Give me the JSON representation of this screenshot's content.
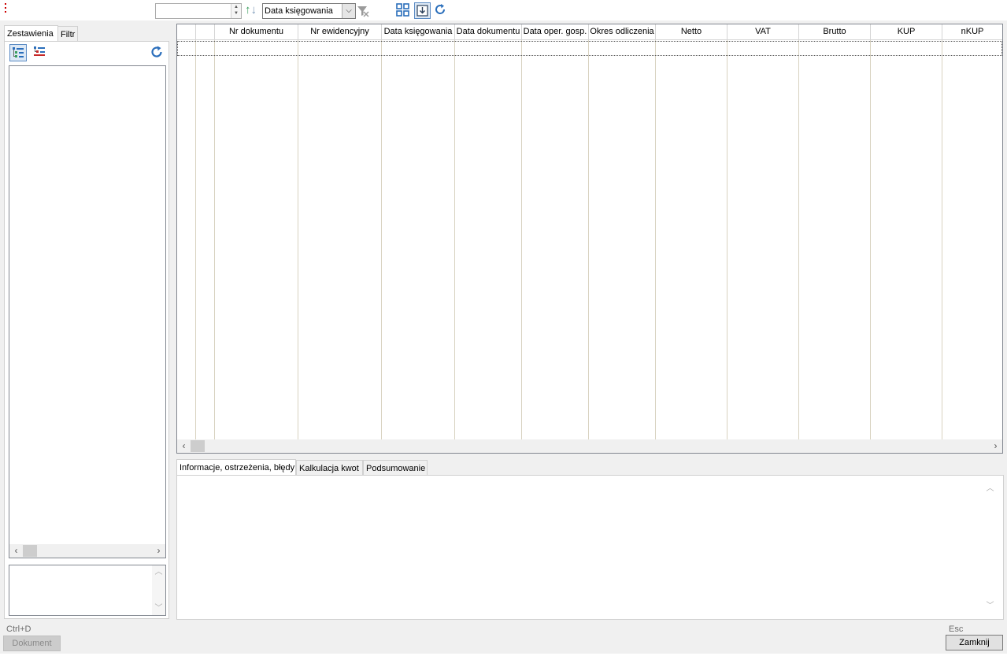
{
  "toolbar": {
    "spin_value": "",
    "sort_combo_value": "Data księgowania"
  },
  "left_tabs": [
    {
      "label": "Zestawienia",
      "active": true
    },
    {
      "label": "Filtr",
      "active": false
    }
  ],
  "grid": {
    "columns": [
      "",
      "",
      "Nr dokumentu",
      "Nr ewidencyjny",
      "Data księgowania",
      "Data dokumentu",
      "Data oper. gosp.",
      "Okres odliczenia",
      "Netto",
      "VAT",
      "Brutto",
      "KUP",
      "nKUP"
    ],
    "rows": []
  },
  "bottom_tabs": [
    {
      "label": "Informacje, ostrzeżenia, błędy",
      "active": true
    },
    {
      "label": "Kalkulacja kwot",
      "active": false
    },
    {
      "label": "Podsumowanie",
      "active": false
    }
  ],
  "footer": {
    "dokument_shortcut": "Ctrl+D",
    "dokument_label": "Dokument",
    "close_shortcut": "Esc",
    "close_label": "Zamknij"
  },
  "colors": {
    "accent_blue": "#2a6ebb",
    "sort_up": "#3a9d5d",
    "grid_lines": "#d8d2c0"
  }
}
